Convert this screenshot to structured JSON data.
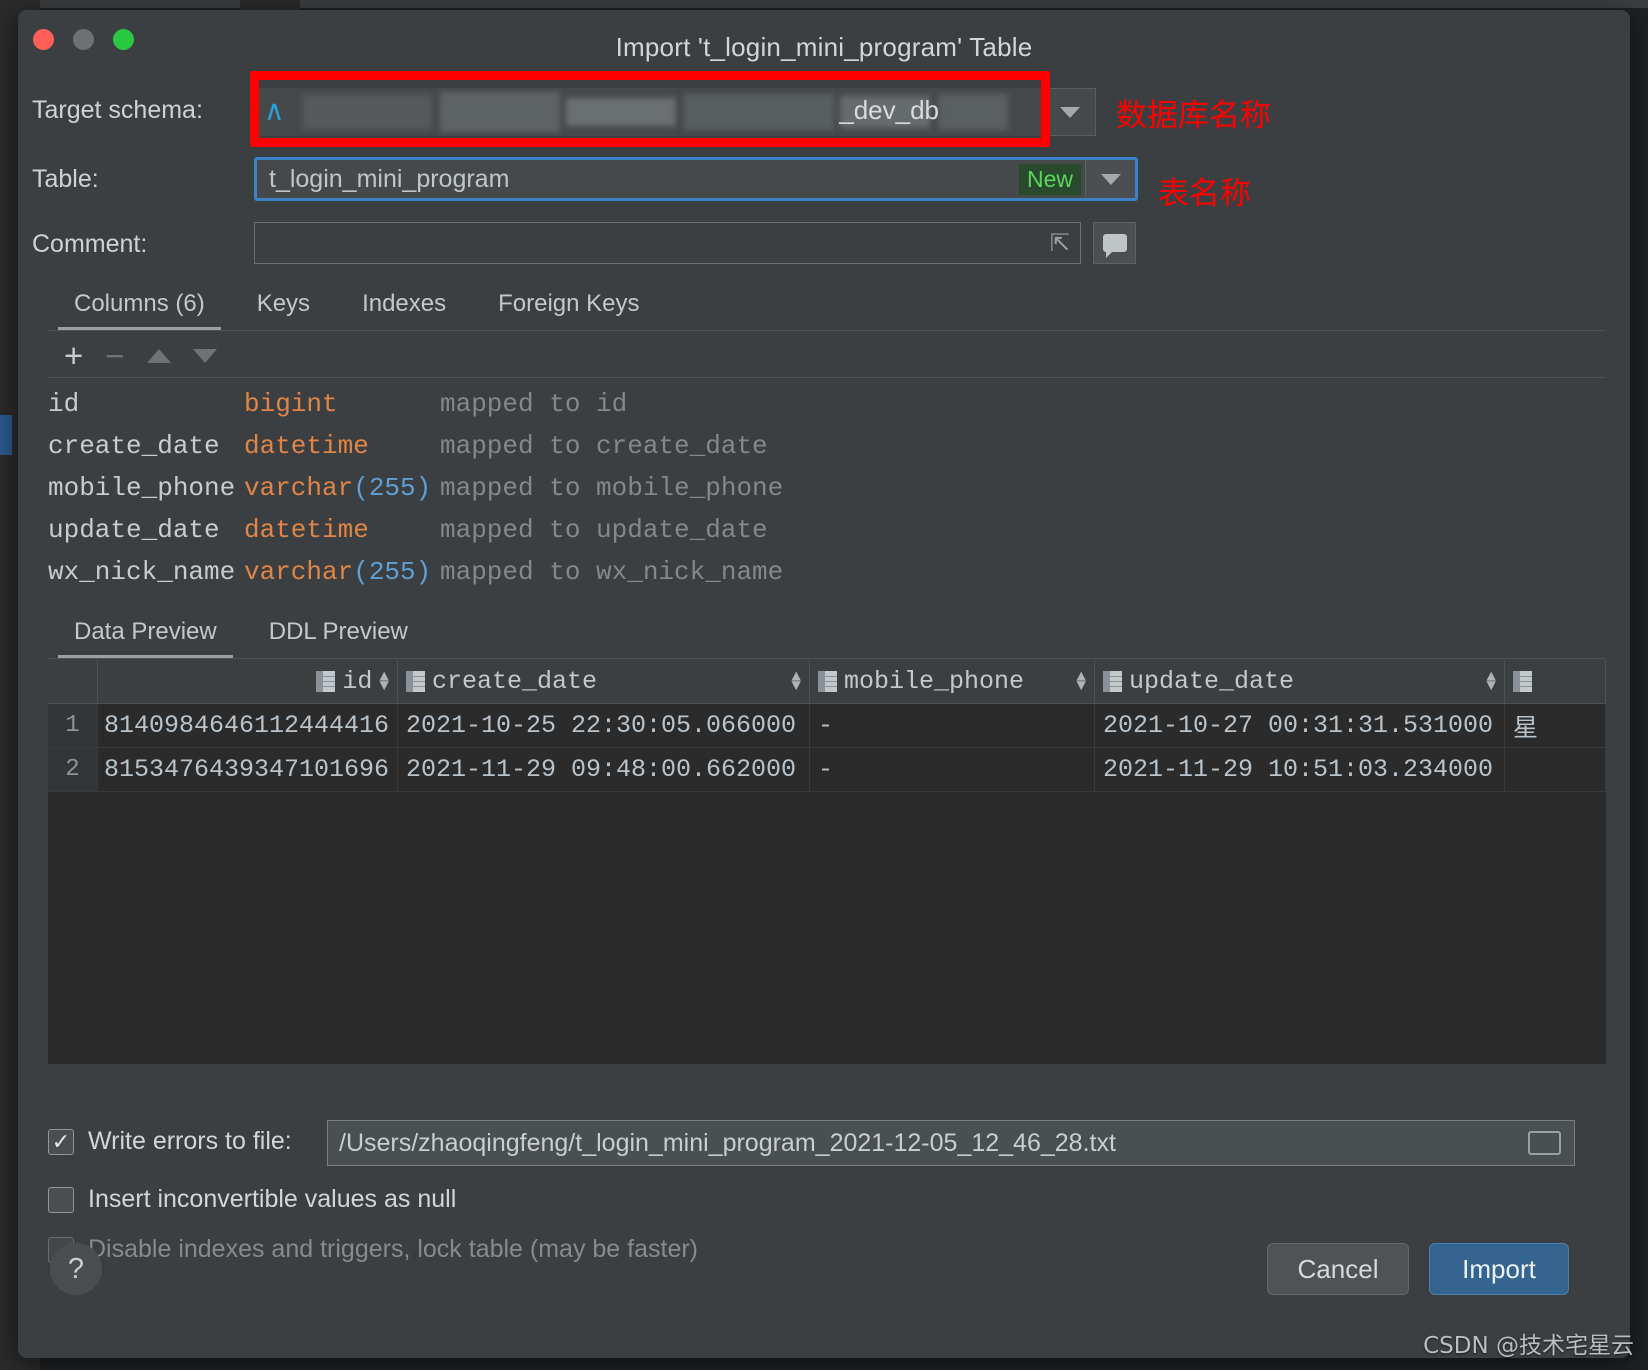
{
  "window": {
    "title": "Import 't_login_mini_program' Table",
    "traffic_lights": [
      "close",
      "minimize",
      "zoom"
    ]
  },
  "form": {
    "schema_label": "Target schema:",
    "schema_value_visible": "_dev_db",
    "schema_redacted": true,
    "table_label": "Table:",
    "table_value": "t_login_mini_program",
    "table_badge": "New",
    "comment_label": "Comment:",
    "comment_value": ""
  },
  "annotations": [
    {
      "text": "数据库名称",
      "meaning": "database-name"
    },
    {
      "text": "表名称",
      "meaning": "table-name"
    }
  ],
  "tabs": [
    {
      "label": "Columns (6)",
      "active": true
    },
    {
      "label": "Keys",
      "active": false
    },
    {
      "label": "Indexes",
      "active": false
    },
    {
      "label": "Foreign Keys",
      "active": false
    }
  ],
  "toolbar": {
    "add": "+",
    "remove": "−",
    "move_up": "▲",
    "move_down": "▼"
  },
  "columns": [
    {
      "name": "id",
      "type": "bigint",
      "length": "",
      "mapping": "mapped to id"
    },
    {
      "name": "create_date",
      "type": "datetime",
      "length": "",
      "mapping": "mapped to create_date"
    },
    {
      "name": "mobile_phone",
      "type": "varchar",
      "length": "255",
      "mapping": "mapped to mobile_phone"
    },
    {
      "name": "update_date",
      "type": "datetime",
      "length": "",
      "mapping": "mapped to update_date"
    },
    {
      "name": "wx_nick_name",
      "type": "varchar",
      "length": "255",
      "mapping": "mapped to wx_nick_name"
    }
  ],
  "preview_tabs": [
    {
      "label": "Data Preview",
      "active": true
    },
    {
      "label": "DDL Preview",
      "active": false
    }
  ],
  "data_preview": {
    "headers": [
      "id",
      "create_date",
      "mobile_phone",
      "update_date",
      ""
    ],
    "rows": [
      {
        "num": "1",
        "id": "8140984646112444416",
        "create_date": "2021-10-25 22:30:05.066000",
        "mobile_phone": "-",
        "update_date": "2021-10-27 00:31:31.531000",
        "extra": "星"
      },
      {
        "num": "2",
        "id": "8153476439347101696",
        "create_date": "2021-11-29 09:48:00.662000",
        "mobile_phone": "-",
        "update_date": "2021-11-29 10:51:03.234000",
        "extra": ""
      }
    ]
  },
  "options": {
    "write_errors_label": "Write errors to file:",
    "write_errors_checked": true,
    "error_file_path": "/Users/zhaoqingfeng/t_login_mini_program_2021-12-05_12_46_28.txt",
    "insert_inconvertible_label": "Insert inconvertible values as null",
    "insert_inconvertible_checked": false,
    "disable_indexes_label": "Disable indexes and triggers, lock table (may be faster)",
    "disable_indexes_checked": false,
    "disable_indexes_enabled": false
  },
  "footer": {
    "help": "?",
    "cancel_label": "Cancel",
    "import_label": "Import"
  },
  "watermark": "CSDN @技术宅星云",
  "colors": {
    "dialog_bg": "#3c3f41",
    "accent_blue": "#3b83c4",
    "import_blue": "#34648f",
    "annotation_red": "#ff0000",
    "type_orange": "#e08545",
    "length_blue": "#5f9fd4",
    "new_badge_green": "#5bd75b"
  }
}
